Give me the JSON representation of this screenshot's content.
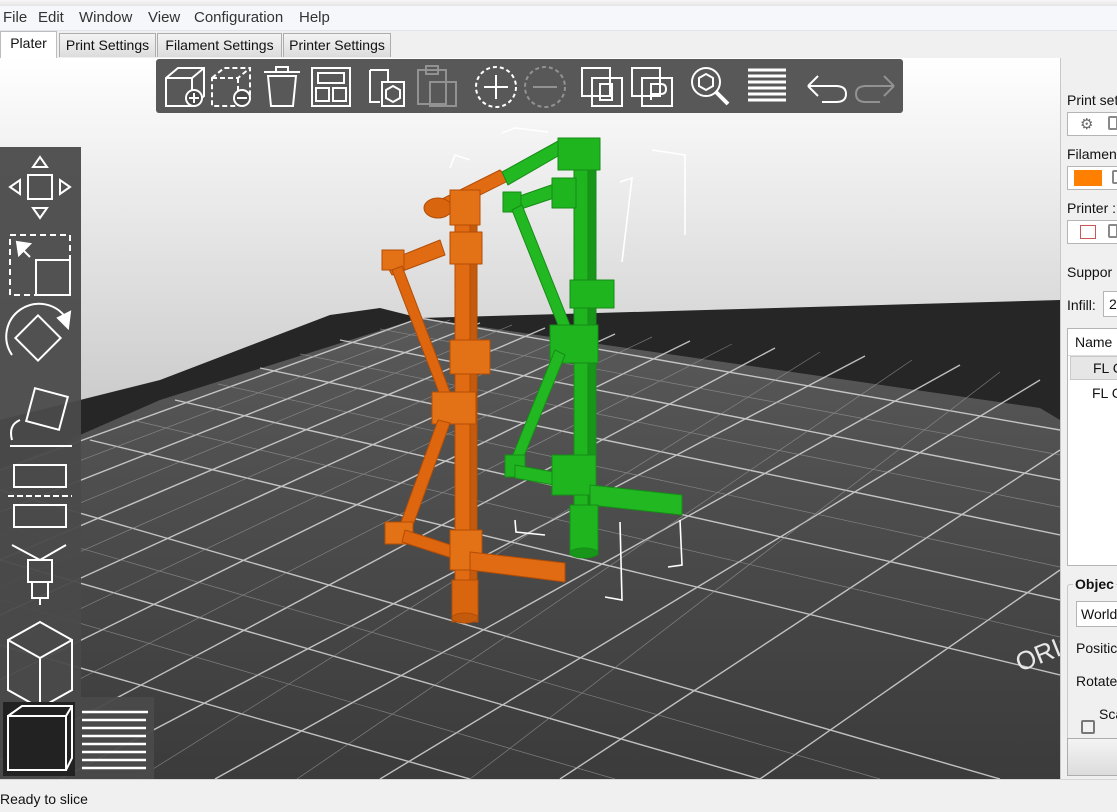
{
  "menu": {
    "items": [
      "File",
      "Edit",
      "Window",
      "View",
      "Configuration",
      "Help"
    ]
  },
  "tabs": [
    "Plater",
    "Print Settings",
    "Filament Settings",
    "Printer Settings"
  ],
  "toolbar": {
    "icons": [
      "add-icon",
      "delete-icon",
      "delete-all-icon",
      "arrange-icon",
      "copy-icon",
      "paste-icon",
      "add-instance-icon",
      "remove-instance-icon",
      "split-to-objects-icon",
      "split-to-parts-icon",
      "search-icon",
      "layers-editing-icon",
      "undo-icon",
      "redo-icon"
    ]
  },
  "gizmos": {
    "icons": [
      "move-icon",
      "scale-icon",
      "rotate-icon",
      "place-on-face-icon",
      "cut-icon",
      "paint-supports-icon",
      "3d-view-icon",
      "preview-layers-icon"
    ]
  },
  "right_panel": {
    "print_settings_label": "Print set",
    "filament_label": "Filamen",
    "filament_color": "#ff8000",
    "printer_label": "Printer :",
    "support_label": "Suppor",
    "infill_label": "Infill:",
    "infill_value": "2",
    "list_header": "Name",
    "list_items": [
      "FL C",
      "FL C"
    ],
    "object_manip_label": "Objec",
    "coordinates_value": "World",
    "position_label": "Positic",
    "rotate_label": "Rotate",
    "scale_label": "Sca"
  },
  "bed": {
    "label": "ORIG"
  },
  "status": {
    "text": "Ready to slice"
  },
  "colors": {
    "orange_part": "#e06b12",
    "green_part": "#1fb51f",
    "bed": "#4a4a4a"
  }
}
